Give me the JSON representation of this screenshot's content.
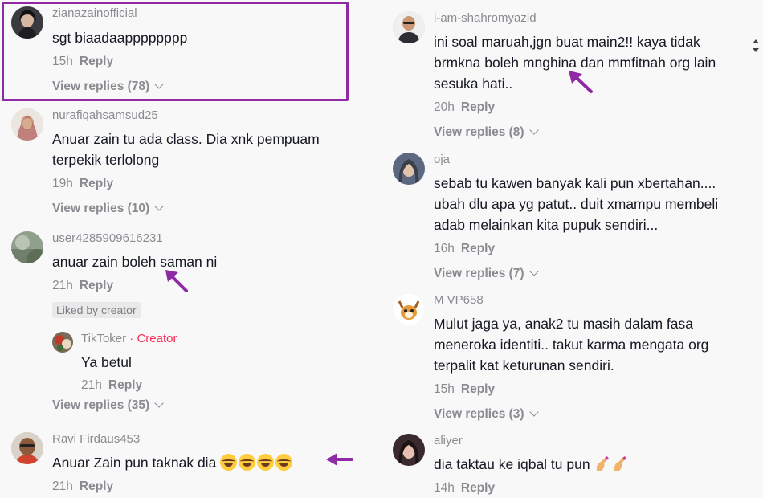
{
  "left_comments": [
    {
      "username": "zianazainofficial",
      "text": "sgt biaadaapppppppp",
      "time": "15h",
      "reply": "Reply",
      "view_replies": "View replies (78)"
    },
    {
      "username": "nurafiqahsamsud25",
      "text_lines": [
        "Anuar zain tu ada class. Dia xnk pempuam",
        "terpekik terlolong"
      ],
      "time": "19h",
      "reply": "Reply",
      "view_replies": "View replies (10)"
    },
    {
      "username": "user4285909616231",
      "text": "anuar zain boleh saman ni",
      "time": "21h",
      "reply": "Reply",
      "liked": "Liked by creator",
      "nested": {
        "username": "TikToker",
        "separator": "·",
        "badge": "Creator",
        "text": "Ya betul",
        "time": "21h",
        "reply": "Reply"
      },
      "view_replies": "View replies (35)"
    },
    {
      "username": "Ravi Firdaus453",
      "text": "Anuar Zain pun taknak dia",
      "time": "21h",
      "reply": "Reply"
    }
  ],
  "right_comments": [
    {
      "username": "i-am-shahromyazid",
      "text_lines": [
        "ini soal maruah,jgn buat main2!! kaya tidak",
        "brmkna boleh mnghina dan mmfitnah org lain",
        "sesuka hati.."
      ],
      "time": "20h",
      "reply": "Reply",
      "view_replies": "View replies (8)"
    },
    {
      "username": "oja",
      "text_lines": [
        "sebab tu kawen banyak kali pun xbertahan....",
        "ubah dlu apa yg patut.. duit xmampu membeli",
        "adab melainkan kita pupuk sendiri..."
      ],
      "time": "16h",
      "reply": "Reply",
      "view_replies": "View replies (7)"
    },
    {
      "username": "M VP658",
      "text_lines": [
        "Mulut jaga ya, anak2 tu masih dalam fasa",
        "meneroka identiti.. takut karma mengata org",
        "terpalit kat keturunan sendiri."
      ],
      "time": "15h",
      "reply": "Reply",
      "view_replies": "View replies (3)"
    },
    {
      "username": "aliyer",
      "text": "dia taktau ke iqbal tu pun",
      "time": "14h",
      "reply": "Reply"
    }
  ],
  "colors": {
    "highlight": "#8e2aa3",
    "creator": "#fe2c55",
    "meta": "#8a8b91",
    "text": "#161823"
  }
}
